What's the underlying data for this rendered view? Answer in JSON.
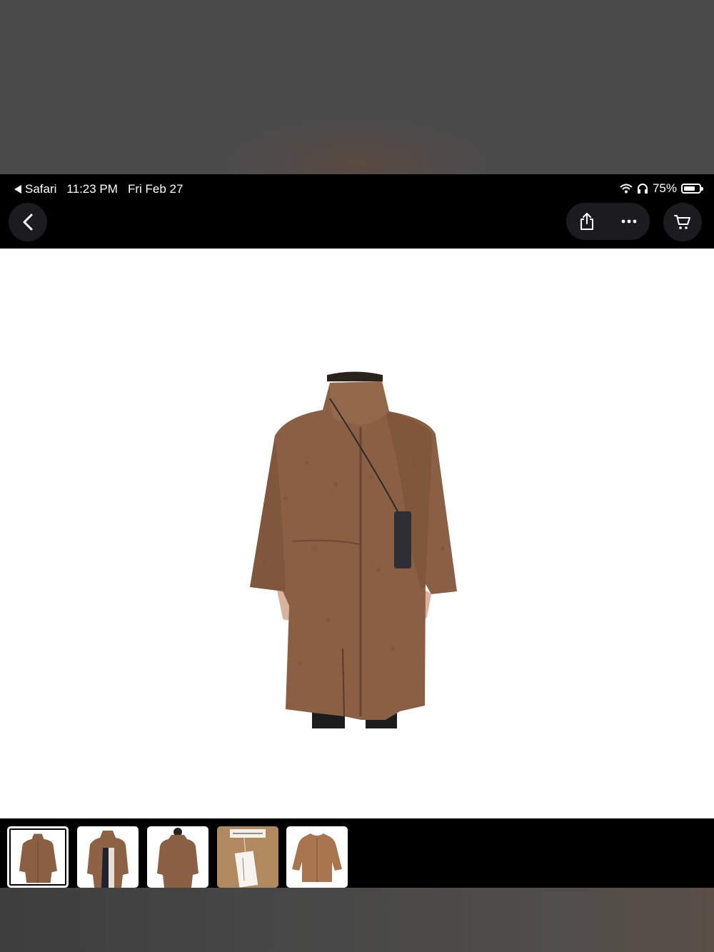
{
  "status_bar": {
    "back_app_label": "Safari",
    "time": "11:23 PM",
    "date": "Fri Feb 27",
    "battery_percent": "75%",
    "battery_level": 0.75
  },
  "nav": {
    "back_icon": "chevron-left-icon",
    "share_icon": "share-icon",
    "more_icon": "ellipsis-icon",
    "cart_icon": "cart-icon"
  },
  "gallery": {
    "main_image": "brown-teddy-coat-front",
    "thumbnails": [
      {
        "name": "coat-front",
        "selected": true
      },
      {
        "name": "coat-open",
        "selected": false
      },
      {
        "name": "coat-back",
        "selected": false
      },
      {
        "name": "coat-label-tag",
        "selected": false
      },
      {
        "name": "coat-flat",
        "selected": false
      }
    ]
  },
  "colors": {
    "coat": "#8a5f43",
    "bar_bg": "#000000",
    "button_bg": "#1c1c1e"
  }
}
